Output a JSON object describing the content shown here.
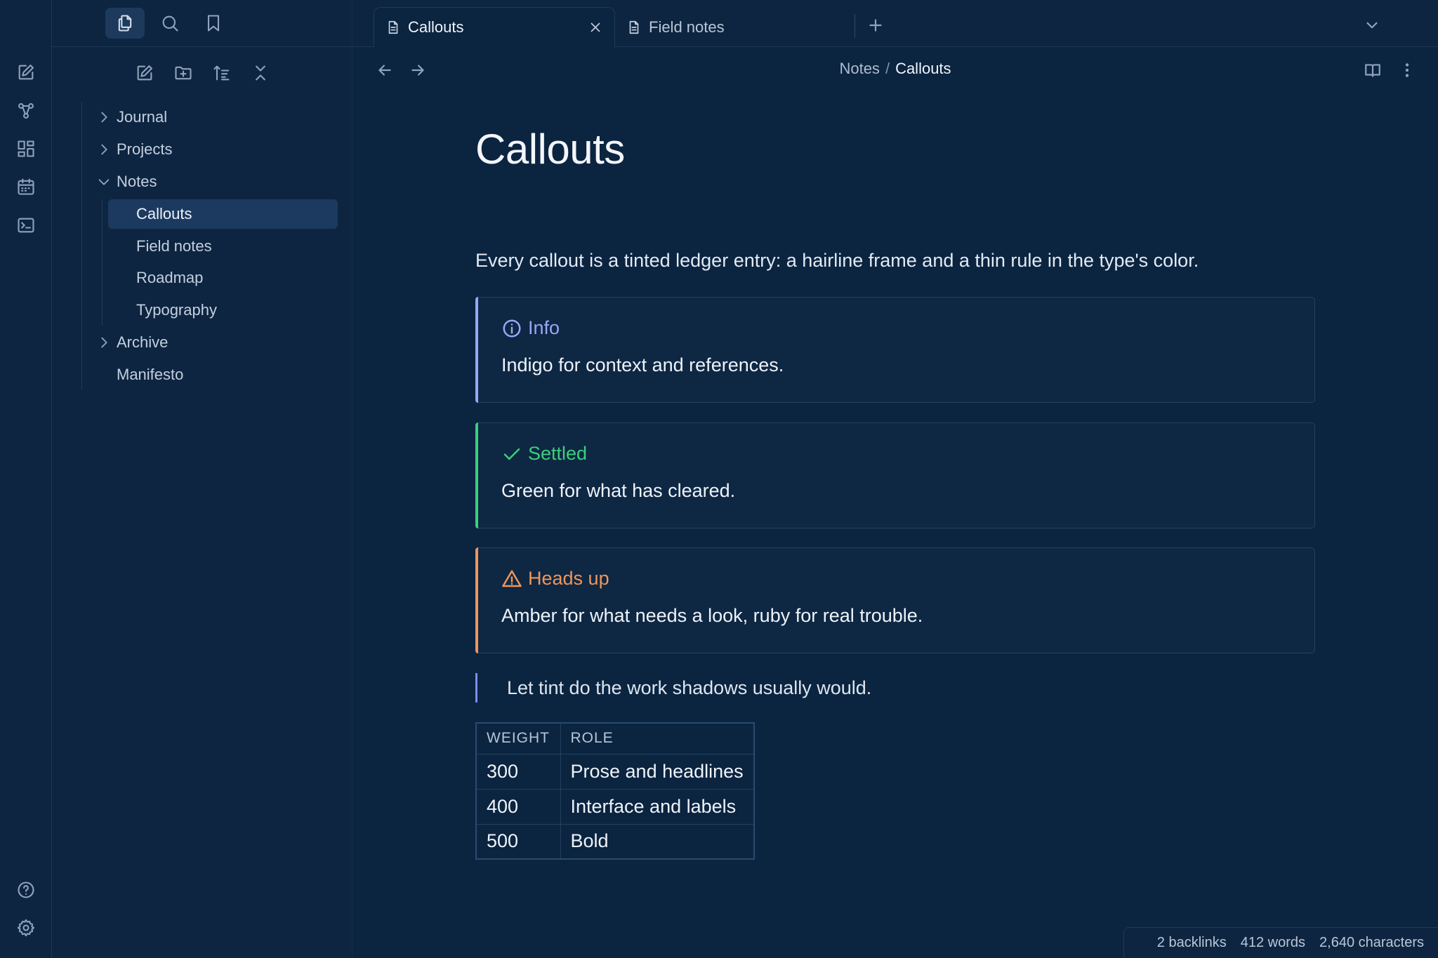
{
  "tabs": [
    {
      "label": "Callouts",
      "active": true
    },
    {
      "label": "Field notes",
      "active": false
    }
  ],
  "sidebar": {
    "tree": [
      {
        "label": "Journal",
        "type": "folder",
        "expanded": false
      },
      {
        "label": "Projects",
        "type": "folder",
        "expanded": false
      },
      {
        "label": "Notes",
        "type": "folder",
        "expanded": true
      },
      {
        "label": "Callouts",
        "type": "file",
        "active": true
      },
      {
        "label": "Field notes",
        "type": "file"
      },
      {
        "label": "Roadmap",
        "type": "file"
      },
      {
        "label": "Typography",
        "type": "file"
      },
      {
        "label": "Archive",
        "type": "folder",
        "expanded": false
      },
      {
        "label": "Manifesto",
        "type": "file"
      }
    ]
  },
  "breadcrumb": {
    "parent": "Notes",
    "separator": "/",
    "current": "Callouts"
  },
  "doc": {
    "title": "Callouts",
    "intro": "Every callout is a tinted ledger entry: a hairline frame and a thin rule in the type's color.",
    "callouts": [
      {
        "title": "Info",
        "body": "Indigo for context and references.",
        "color": "#9aa6f5",
        "icon": "info-icon"
      },
      {
        "title": "Settled",
        "body": "Green for what has cleared.",
        "color": "#3ccf7a",
        "icon": "check-icon"
      },
      {
        "title": "Heads up",
        "body": "Amber for what needs a look, ruby for real trouble.",
        "color": "#f0955a",
        "icon": "warning-icon"
      }
    ],
    "quote": "Let tint do the work shadows usually would.",
    "table": {
      "headers": [
        "WEIGHT",
        "ROLE"
      ],
      "rows": [
        [
          "300",
          "Prose and headlines"
        ],
        [
          "400",
          "Interface and labels"
        ],
        [
          "500",
          "Bold"
        ]
      ]
    }
  },
  "status": {
    "backlinks": "2 backlinks",
    "words": "412 words",
    "characters": "2,640 characters"
  },
  "colors": {
    "background": "#0b2440",
    "sidebar": "#0e2541",
    "accent": "#1c3a60"
  }
}
